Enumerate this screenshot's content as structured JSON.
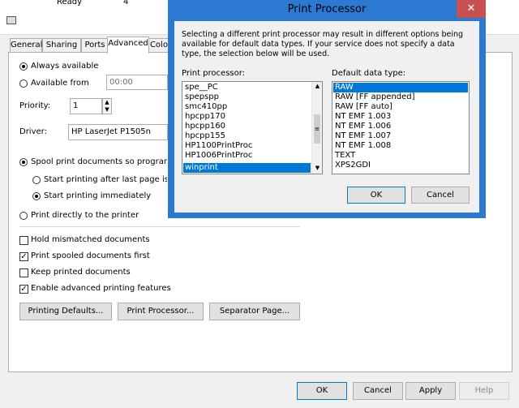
{
  "top_strip": {
    "status": "Ready",
    "count": "4"
  },
  "tabs": [
    "General",
    "Sharing",
    "Ports",
    "Advanced",
    "Color"
  ],
  "availability": {
    "always_label": "Always available",
    "from_label": "Available from",
    "from_time": "00:00"
  },
  "priority": {
    "label": "Priority:",
    "value": "1"
  },
  "driver": {
    "label": "Driver:",
    "value": "HP LaserJet P1505n"
  },
  "spool": {
    "spool_label": "Spool print documents so program fini",
    "after_last_label": "Start printing after last page is spoo",
    "immediately_label": "Start printing immediately",
    "direct_label": "Print directly to the printer"
  },
  "checkboxes": [
    {
      "label": "Hold mismatched documents",
      "checked": false
    },
    {
      "label": "Print spooled documents first",
      "checked": true
    },
    {
      "label": "Keep printed documents",
      "checked": false
    },
    {
      "label": "Enable advanced printing features",
      "checked": true
    }
  ],
  "panel_buttons": {
    "defaults": "Printing Defaults...",
    "processor": "Print Processor...",
    "separator": "Separator Page..."
  },
  "bottom_buttons": {
    "ok": "OK",
    "cancel": "Cancel",
    "apply": "Apply",
    "help": "Help"
  },
  "dialog": {
    "title": "Print Processor",
    "close": "✕",
    "message": "Selecting a different print processor may result in different options being available for default data types. If your service does not specify a data type, the selection below will be used.",
    "processor_label": "Print processor:",
    "datatype_label": "Default data type:",
    "processors": [
      "spe__PC",
      "spepspp",
      "smc410pp",
      "hpcpp170",
      "hpcpp160",
      "hpcpp155",
      "HP1100PrintProc",
      "HP1006PrintProc",
      "winprint"
    ],
    "selected_processor": "winprint",
    "datatypes": [
      "RAW",
      "RAW [FF appended]",
      "RAW [FF auto]",
      "NT EMF 1.003",
      "NT EMF 1.006",
      "NT EMF 1.007",
      "NT EMF 1.008",
      "TEXT",
      "XPS2GDI"
    ],
    "selected_datatype": "RAW",
    "ok": "OK",
    "cancel": "Cancel"
  },
  "colors": {
    "accent": "#0078d7",
    "title_bar": "#2b79d1",
    "close_red": "#c75050",
    "dialog_bg": "#f0f0f0"
  }
}
